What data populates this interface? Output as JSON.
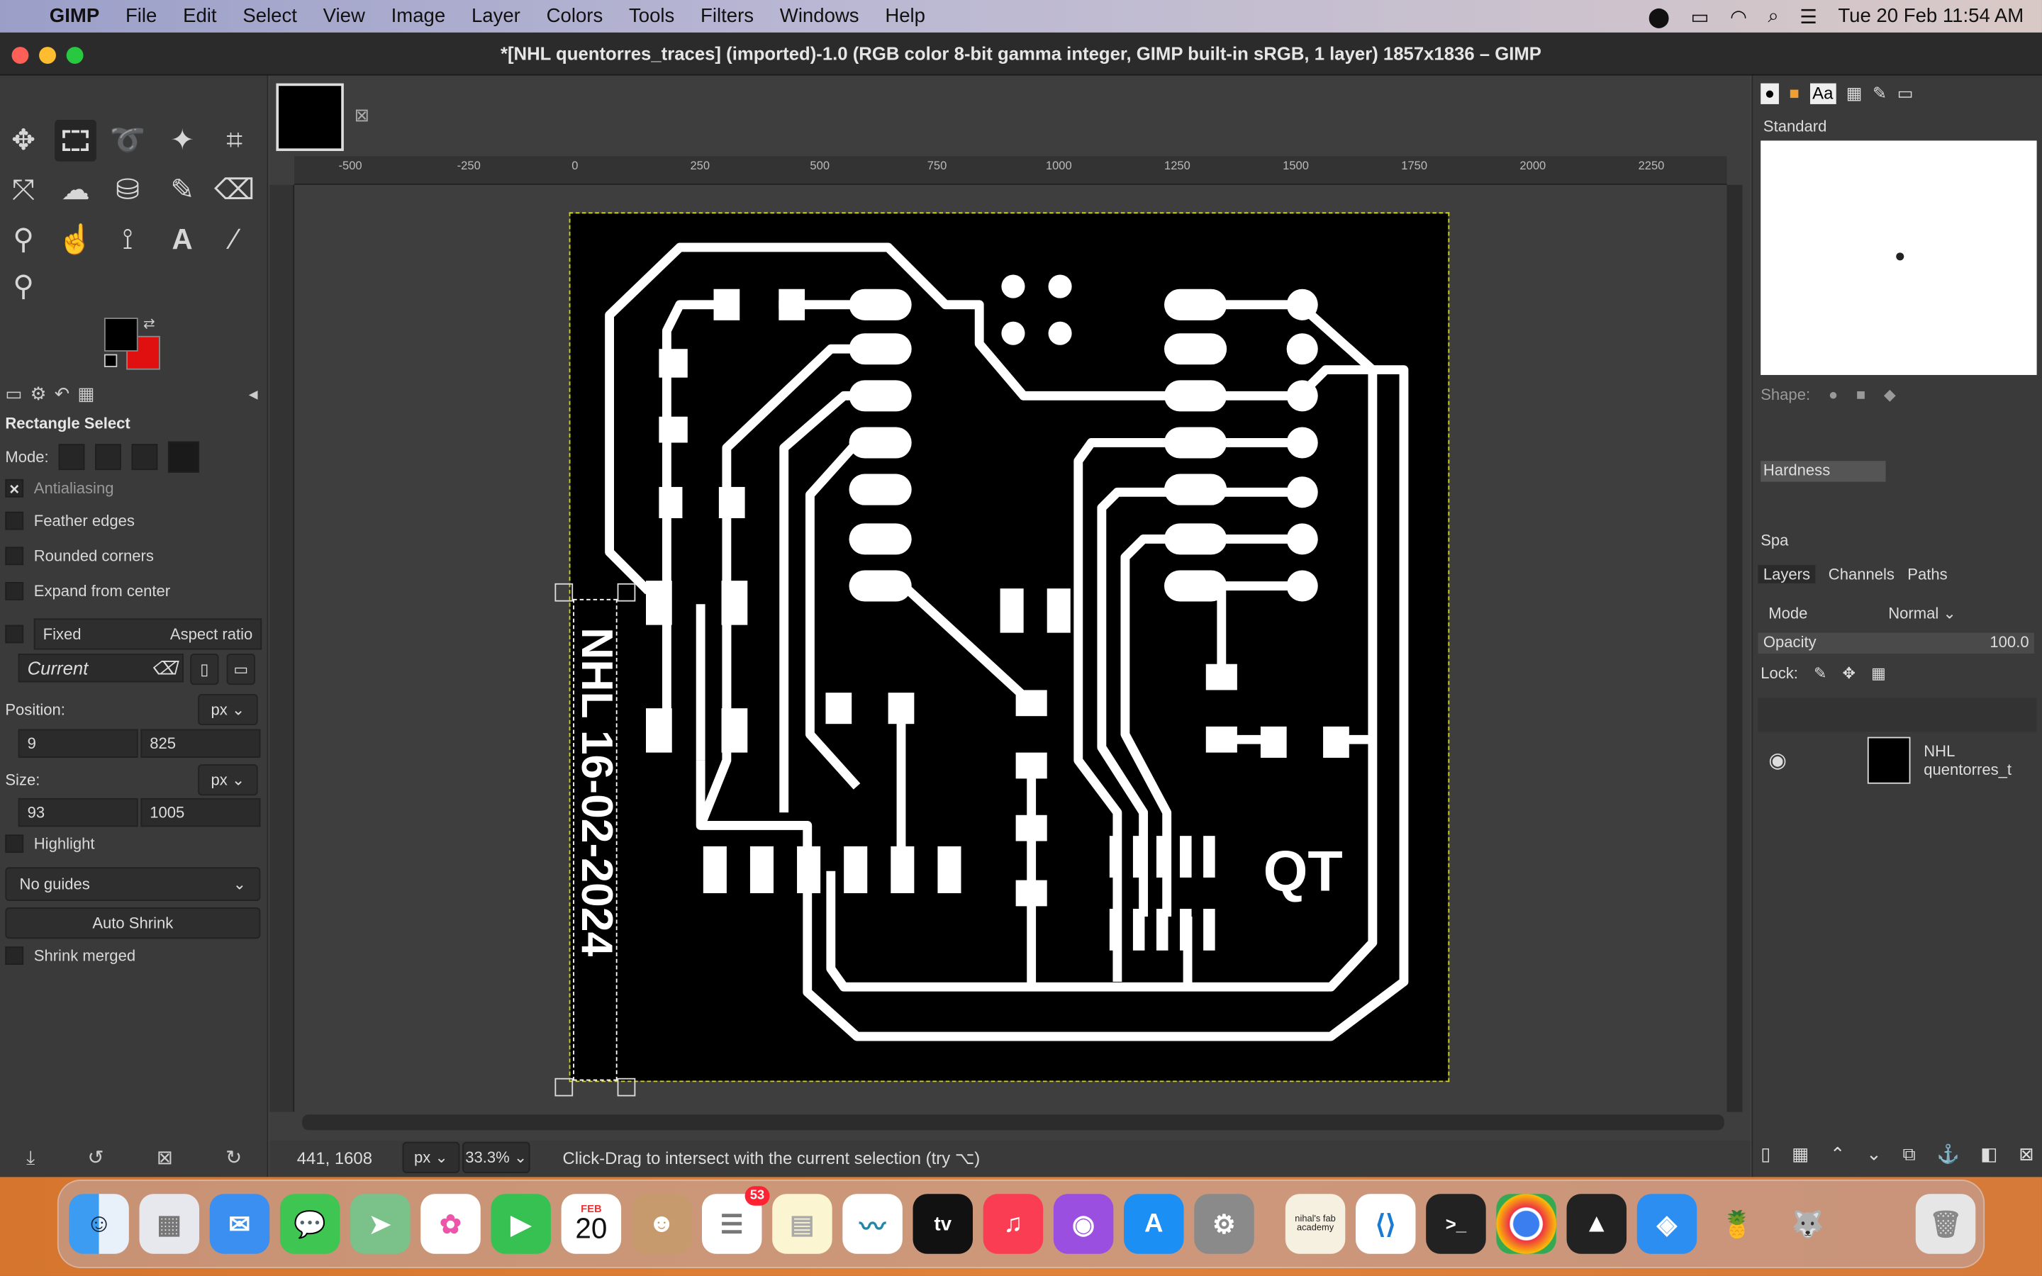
{
  "menubar": {
    "app": "GIMP",
    "items": [
      "File",
      "Edit",
      "Select",
      "View",
      "Image",
      "Layer",
      "Colors",
      "Tools",
      "Filters",
      "Windows",
      "Help"
    ],
    "clock": "Tue 20 Feb  11:54 AM"
  },
  "window": {
    "title": "*[NHL quentorres_traces] (imported)-1.0 (RGB color 8-bit gamma integer, GIMP built-in sRGB, 1 layer) 1857x1836 – GIMP"
  },
  "tool_options": {
    "title": "Rectangle Select",
    "mode_label": "Mode:",
    "antialiasing": "Antialiasing",
    "feather": "Feather edges",
    "rounded": "Rounded corners",
    "expand": "Expand from center",
    "fixed": "Fixed",
    "fixed_value": "Aspect ratio",
    "current": "Current",
    "position_label": "Position:",
    "position_unit": "px",
    "pos_x": "9",
    "pos_y": "825",
    "size_label": "Size:",
    "size_unit": "px",
    "size_w": "93",
    "size_h": "1005",
    "highlight": "Highlight",
    "guides": "No guides",
    "auto_shrink": "Auto Shrink",
    "shrink_merged": "Shrink merged"
  },
  "ruler": {
    "top": [
      "-500",
      "-250",
      "0",
      "250",
      "500",
      "750",
      "1000",
      "1250",
      "1500",
      "1750",
      "2000",
      "2250"
    ]
  },
  "status": {
    "coords": "441, 1608",
    "unit": "px",
    "zoom": "33.3%",
    "message": "Click-Drag to intersect with the current selection (try ⌥)"
  },
  "image_text": {
    "vertical": "NHL 16-02-2024",
    "logo": "QT"
  },
  "brushes": {
    "name": "Standard",
    "shape_label": "Shape:",
    "hardness": "Hardness",
    "spacing": "Spa"
  },
  "layers": {
    "tabs": [
      "Layers",
      "Channels",
      "Paths"
    ],
    "mode_label": "Mode",
    "mode_value": "Normal",
    "opacity_label": "Opacity",
    "opacity_value": "100.0",
    "lock_label": "Lock:",
    "layer_name": "NHL quentorres_t"
  },
  "dock": {
    "calendar_month": "FEB",
    "calendar_day": "20",
    "reminders_badge": "53",
    "notes_tile": "nihal's fab academy"
  }
}
